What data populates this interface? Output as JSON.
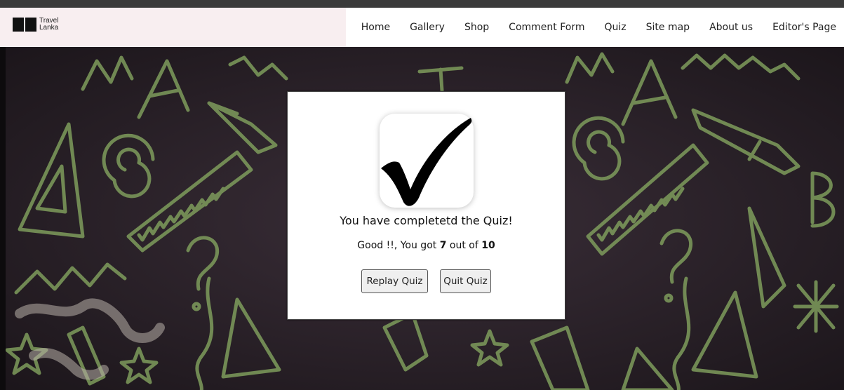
{
  "header": {
    "logo_text_line1": "Travel",
    "logo_text_line2": "Lanka",
    "nav": [
      {
        "label": "Home"
      },
      {
        "label": "Gallery"
      },
      {
        "label": "Shop"
      },
      {
        "label": "Comment Form"
      },
      {
        "label": "Quiz"
      },
      {
        "label": "Site map"
      },
      {
        "label": "About us"
      },
      {
        "label": "Editor's Page"
      }
    ]
  },
  "background": {
    "doodle_color": "#7e9c5c",
    "base_color": "#2a2028"
  },
  "modal": {
    "icon": "checkmark-icon",
    "title": "You have completetd the Quiz!",
    "score_prefix": "Good !!, You got ",
    "score_value": "7",
    "score_mid": " out of ",
    "score_total": "10",
    "replay_label": "Replay Quiz",
    "quit_label": "Quit Quiz"
  }
}
